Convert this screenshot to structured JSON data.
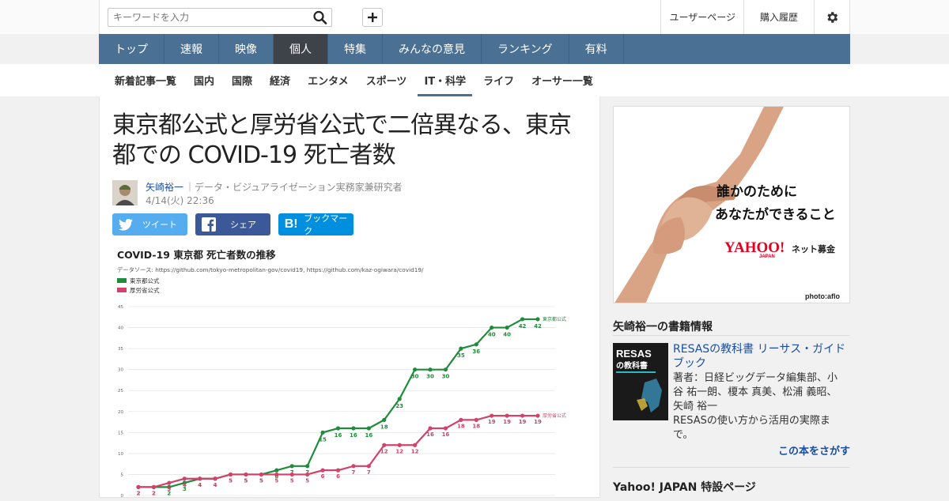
{
  "header": {
    "search_placeholder": "キーワードを入力",
    "user_page": "ユーザーページ",
    "purchase_history": "購入履歴"
  },
  "nav": {
    "items": [
      "トップ",
      "速報",
      "映像",
      "個人",
      "特集",
      "みんなの意見",
      "ランキング",
      "有料"
    ],
    "active": "個人"
  },
  "subnav": {
    "items": [
      "新着記事一覧",
      "国内",
      "国際",
      "経済",
      "エンタメ",
      "スポーツ",
      "IT・科学",
      "ライフ",
      "オーサー一覧"
    ],
    "active": "IT・科学"
  },
  "article": {
    "title": "東京都公式と厚労省公式で二倍異なる、東京都での COVID-19 死亡者数",
    "author": "矢崎裕一",
    "author_desc": "｜データ・ビジュアライゼーション実務家兼研究者",
    "date": "4/14(火) 22:36"
  },
  "share": {
    "tweet": "ツイート",
    "facebook": "シェア",
    "hatena": "ブックマーク"
  },
  "chart_data": {
    "type": "line",
    "title": "COVID-19 東京都 死亡者数の推移",
    "source": "データソース: https://github.com/tokyo-metropolitan-gov/covid19, https://github.com/kaz-ogiwara/covid19/",
    "ylim": [
      0,
      45
    ],
    "yticks": [
      0,
      5,
      10,
      15,
      20,
      25,
      30,
      35,
      40,
      45
    ],
    "grid": true,
    "legend_position": "top-left",
    "series": [
      {
        "name": "東京都公式",
        "color": "#1f8c3b",
        "end_label": "東京都公式",
        "values": [
          2,
          2,
          2,
          3,
          4,
          4,
          5,
          5,
          5,
          6,
          7,
          7,
          15,
          16,
          16,
          16,
          18,
          23,
          30,
          30,
          30,
          35,
          36,
          40,
          40,
          42,
          42
        ]
      },
      {
        "name": "厚労省公式",
        "color": "#d2426b",
        "end_label": "厚労省公式",
        "values": [
          2,
          2,
          3,
          4,
          4,
          4,
          5,
          5,
          5,
          5,
          5,
          5,
          6,
          6,
          7,
          7,
          12,
          12,
          12,
          16,
          16,
          18,
          18,
          19,
          19,
          19,
          19
        ]
      }
    ]
  },
  "ad": {
    "line1": "誰かのために",
    "line2": "あなたができること",
    "brand": "YAHOO!",
    "brand_sub": "JAPAN",
    "service": "ネット募金",
    "credit": "photo:aflo"
  },
  "books": {
    "heading": "矢崎裕一の書籍情報",
    "title": "RESASの教科書 リーサス・ガイドブック",
    "authors": "著者：日経ビッグデータ編集部、小谷 祐一朗、榎本 真美、松浦 義昭、矢崎 裕一",
    "desc": "RESASの使い方から活用の実際まで。",
    "find": "この本をさがす",
    "cover_title": "RESAS",
    "cover_sub": "の教科書"
  },
  "special": {
    "heading": "Yahoo! JAPAN 特設ページ"
  }
}
